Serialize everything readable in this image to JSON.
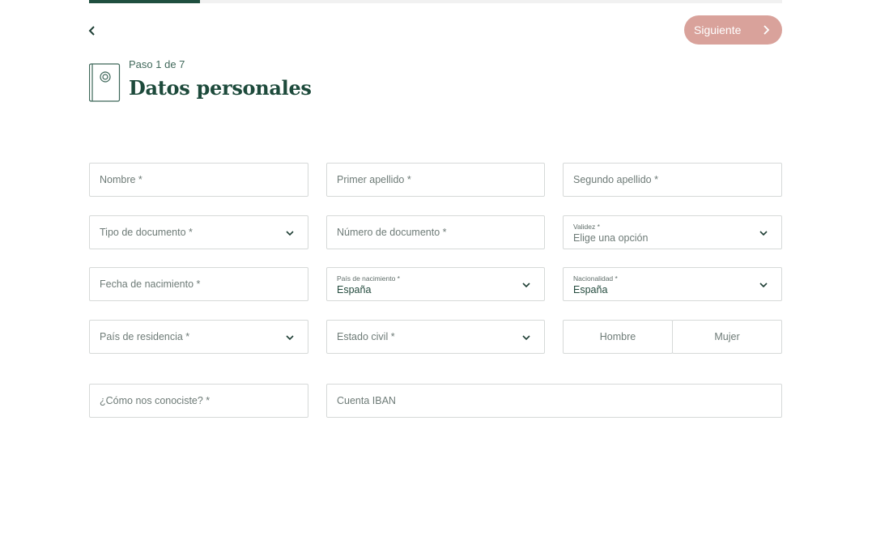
{
  "progress": {
    "fraction": 0.16
  },
  "header": {
    "step": "Paso 1 de 7",
    "title": "Datos personales",
    "next_label": "Siguiente"
  },
  "form": {
    "nombre": {
      "placeholder": "Nombre *"
    },
    "primer_apellido": {
      "placeholder": "Primer apellido *"
    },
    "segundo_apellido": {
      "placeholder": "Segundo apellido *"
    },
    "tipo_documento": {
      "placeholder": "Tipo de documento *"
    },
    "numero_documento": {
      "placeholder": "Número de documento *"
    },
    "validez": {
      "label": "Validez *",
      "value": "Elige una opción"
    },
    "fecha_nacimiento": {
      "placeholder": "Fecha de nacimiento *"
    },
    "pais_nacimiento": {
      "label": "País de nacimiento *",
      "value": "España"
    },
    "nacionalidad": {
      "label": "Nacionalidad *",
      "value": "España"
    },
    "pais_residencia": {
      "placeholder": "País de residencia *"
    },
    "estado_civil": {
      "placeholder": "Estado civil *"
    },
    "sexo": {
      "hombre": "Hombre",
      "mujer": "Mujer"
    },
    "como_conociste": {
      "placeholder": "¿Cómo nos conociste? *"
    },
    "iban": {
      "placeholder": "Cuenta IBAN"
    }
  },
  "colors": {
    "accent": "#1f4f3f",
    "next_button": "#d9a29b",
    "border": "#d6d9d8"
  },
  "icons": {
    "back": "chevron-left-icon",
    "next": "chevron-right-icon",
    "document": "document-icon",
    "dropdown": "chevron-down-icon"
  }
}
